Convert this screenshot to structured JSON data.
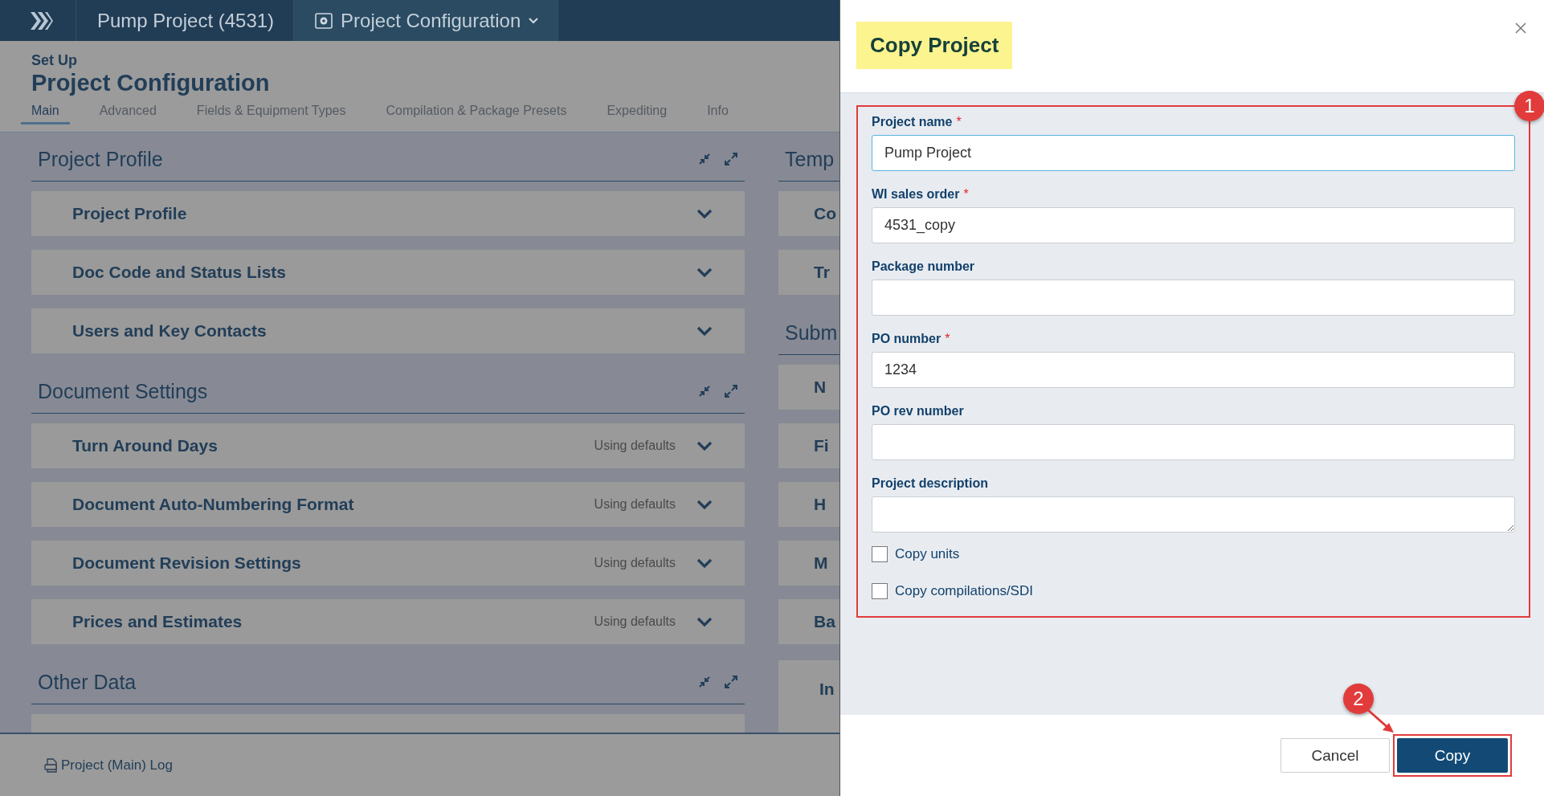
{
  "topbar": {
    "breadcrumbs": [
      {
        "label": "Pump Project (4531)",
        "kind": "link"
      },
      {
        "label": "Project Configuration",
        "kind": "dropdown"
      }
    ]
  },
  "header": {
    "eyebrow": "Set Up",
    "title": "Project Configuration"
  },
  "tabs": [
    {
      "label": "Main",
      "selected": true
    },
    {
      "label": "Advanced",
      "selected": false
    },
    {
      "label": "Fields & Equipment Types",
      "selected": false
    },
    {
      "label": "Compilation & Package Presets",
      "selected": false
    },
    {
      "label": "Expediting",
      "selected": false
    },
    {
      "label": "Info",
      "selected": false
    }
  ],
  "left_sections": [
    {
      "title": "Project Profile",
      "items": [
        {
          "title": "Project Profile"
        },
        {
          "title": "Doc Code and Status Lists"
        },
        {
          "title": "Users and Key Contacts"
        }
      ]
    },
    {
      "title": "Document Settings",
      "items": [
        {
          "title": "Turn Around Days",
          "status": "Using defaults"
        },
        {
          "title": "Document Auto-Numbering Format",
          "status": "Using defaults"
        },
        {
          "title": "Document Revision Settings",
          "status": "Using defaults"
        },
        {
          "title": "Prices and Estimates",
          "status": "Using defaults"
        }
      ]
    },
    {
      "title": "Other Data"
    }
  ],
  "right_sections": [
    {
      "title": "Temp",
      "items": [
        {
          "title": "Co"
        },
        {
          "title": "Tr"
        }
      ]
    },
    {
      "title": "Subm",
      "items": [
        {
          "title": "N"
        },
        {
          "title": "Fi"
        },
        {
          "title": "H"
        },
        {
          "title": "M"
        },
        {
          "title": "Ba"
        }
      ]
    }
  ],
  "right_card": {
    "title": "In"
  },
  "status_bar": {
    "log_link": "Project (Main) Log"
  },
  "dialog": {
    "title": "Copy Project",
    "fields": [
      {
        "label": "Project name",
        "required_mark": "*",
        "value": "Pump Project",
        "kind": "text",
        "focused": true
      },
      {
        "label": "WI sales order",
        "required_mark": "*",
        "value": "4531_copy",
        "kind": "text",
        "focused": false
      },
      {
        "label": "Package number",
        "kind": "text",
        "focused": false
      },
      {
        "label": "PO number",
        "required_mark": "*",
        "value": "1234",
        "kind": "text",
        "focused": false
      },
      {
        "label": "PO rev number",
        "kind": "text",
        "focused": false
      },
      {
        "label": "Project description",
        "kind": "textarea",
        "focused": false
      }
    ],
    "checkboxes": [
      {
        "label": "Copy units",
        "checked": false
      },
      {
        "label": "Copy compilations/SDI",
        "checked": false
      }
    ],
    "buttons": [
      {
        "label": "Cancel",
        "kind": "secondary"
      },
      {
        "label": "Copy",
        "kind": "primary"
      }
    ]
  },
  "annotations": [
    {
      "number": "1"
    },
    {
      "number": "2"
    }
  ]
}
